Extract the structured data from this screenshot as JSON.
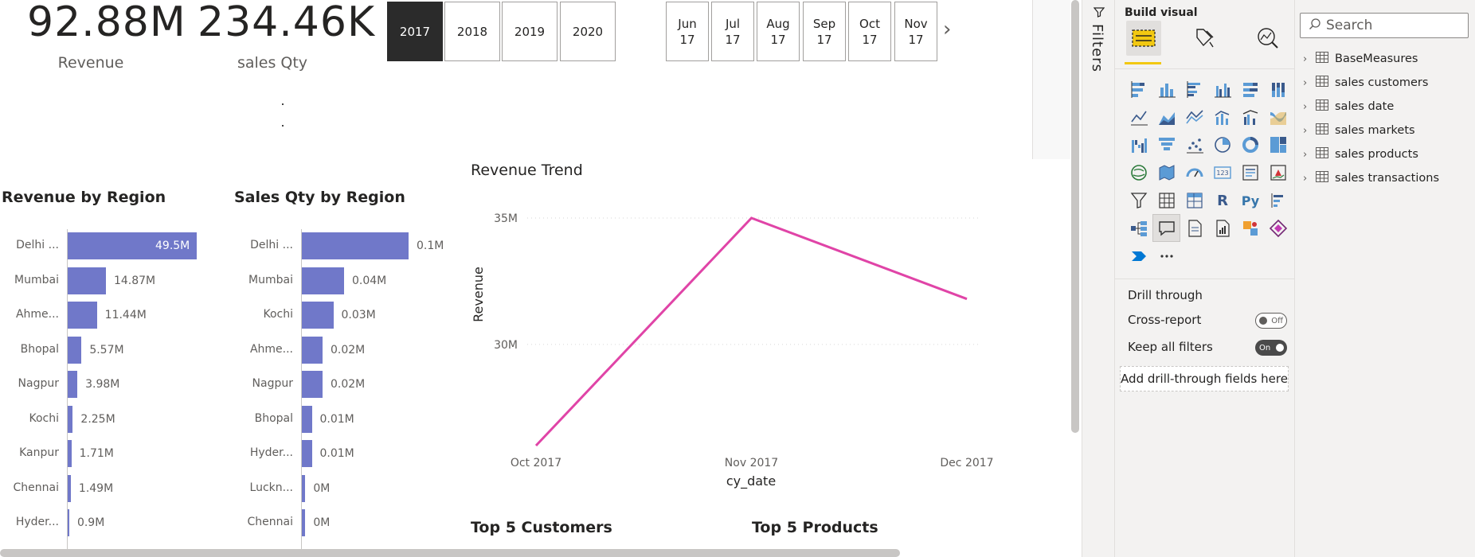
{
  "kpis": [
    {
      "value": "92.88M",
      "label": "Revenue"
    },
    {
      "value": "234.46K",
      "label": "sales Qty"
    }
  ],
  "year_slicer": {
    "items": [
      "2017",
      "2018",
      "2019",
      "2020"
    ],
    "selected": "2017"
  },
  "month_slicer": {
    "items": [
      {
        "month": "Jun",
        "year": "17"
      },
      {
        "month": "Jul",
        "year": "17"
      },
      {
        "month": "Aug",
        "year": "17"
      },
      {
        "month": "Sep",
        "year": "17"
      },
      {
        "month": "Oct",
        "year": "17"
      },
      {
        "month": "Nov",
        "year": "17"
      }
    ]
  },
  "revenue_by_region": {
    "title": "Revenue by Region",
    "bars": [
      {
        "label": "Delhi ...",
        "value": 49.5,
        "text": "49.5M"
      },
      {
        "label": "Mumbai",
        "value": 14.87,
        "text": "14.87M"
      },
      {
        "label": "Ahme...",
        "value": 11.44,
        "text": "11.44M"
      },
      {
        "label": "Bhopal",
        "value": 5.57,
        "text": "5.57M"
      },
      {
        "label": "Nagpur",
        "value": 3.98,
        "text": "3.98M"
      },
      {
        "label": "Kochi",
        "value": 2.25,
        "text": "2.25M"
      },
      {
        "label": "Kanpur",
        "value": 1.71,
        "text": "1.71M"
      },
      {
        "label": "Chennai",
        "value": 1.49,
        "text": "1.49M"
      },
      {
        "label": "Hyder...",
        "value": 0.9,
        "text": "0.9M"
      }
    ],
    "max": 49.5
  },
  "sales_qty_by_region": {
    "title": "Sales Qty by Region",
    "bars": [
      {
        "label": "Delhi ...",
        "value": 0.1,
        "text": "0.1M"
      },
      {
        "label": "Mumbai",
        "value": 0.04,
        "text": "0.04M"
      },
      {
        "label": "Kochi",
        "value": 0.03,
        "text": "0.03M"
      },
      {
        "label": "Ahme...",
        "value": 0.02,
        "text": "0.02M"
      },
      {
        "label": "Nagpur",
        "value": 0.02,
        "text": "0.02M"
      },
      {
        "label": "Bhopal",
        "value": 0.01,
        "text": "0.01M"
      },
      {
        "label": "Hyder...",
        "value": 0.01,
        "text": "0.01M"
      },
      {
        "label": "Luckn...",
        "value": 0.004,
        "text": "0M"
      },
      {
        "label": "Chennai",
        "value": 0.004,
        "text": "0M"
      }
    ],
    "max": 0.1
  },
  "revenue_trend": {
    "title": "Revenue Trend",
    "xlabel": "cy_date",
    "ylabel": "Revenue"
  },
  "chart_data": [
    {
      "type": "line",
      "title": "Revenue Trend",
      "xlabel": "cy_date",
      "ylabel": "Revenue",
      "categories": [
        "Oct 2017",
        "Nov 2017",
        "Dec 2017"
      ],
      "values": [
        26.0,
        35.0,
        31.8
      ],
      "yticks": [
        "35M",
        "30M"
      ],
      "ytick_values": [
        35,
        30
      ],
      "ylim": [
        26,
        35
      ],
      "color": "#e044a7"
    },
    {
      "type": "bar",
      "title": "Revenue by Region",
      "categories": [
        "Delhi ...",
        "Mumbai",
        "Ahme...",
        "Bhopal",
        "Nagpur",
        "Kochi",
        "Kanpur",
        "Chennai",
        "Hyder..."
      ],
      "values": [
        49.5,
        14.87,
        11.44,
        5.57,
        3.98,
        2.25,
        1.71,
        1.49,
        0.9
      ],
      "color": "#7078c9"
    },
    {
      "type": "bar",
      "title": "Sales Qty by Region",
      "categories": [
        "Delhi ...",
        "Mumbai",
        "Kochi",
        "Ahme...",
        "Nagpur",
        "Bhopal",
        "Hyder...",
        "Luckn...",
        "Chennai"
      ],
      "values": [
        0.1,
        0.04,
        0.03,
        0.02,
        0.02,
        0.01,
        0.01,
        0,
        0
      ],
      "color": "#7078c9"
    }
  ],
  "bottom_titles": {
    "customers": "Top 5 Customers",
    "products": "Top 5 Products"
  },
  "filters_rail": {
    "label": "Filters"
  },
  "build_panel": {
    "title": "Build visual",
    "drill_title": "Drill through",
    "cross_report_label": "Cross-report",
    "cross_report_state": "Off",
    "keep_filters_label": "Keep all filters",
    "keep_filters_state": "On",
    "drop_label": "Add drill-through fields here",
    "accent": "#f2c811"
  },
  "data_pane": {
    "search_placeholder": "Search",
    "tables": [
      "BaseMeasures",
      "sales customers",
      "sales date",
      "sales markets",
      "sales products",
      "sales transactions"
    ]
  }
}
